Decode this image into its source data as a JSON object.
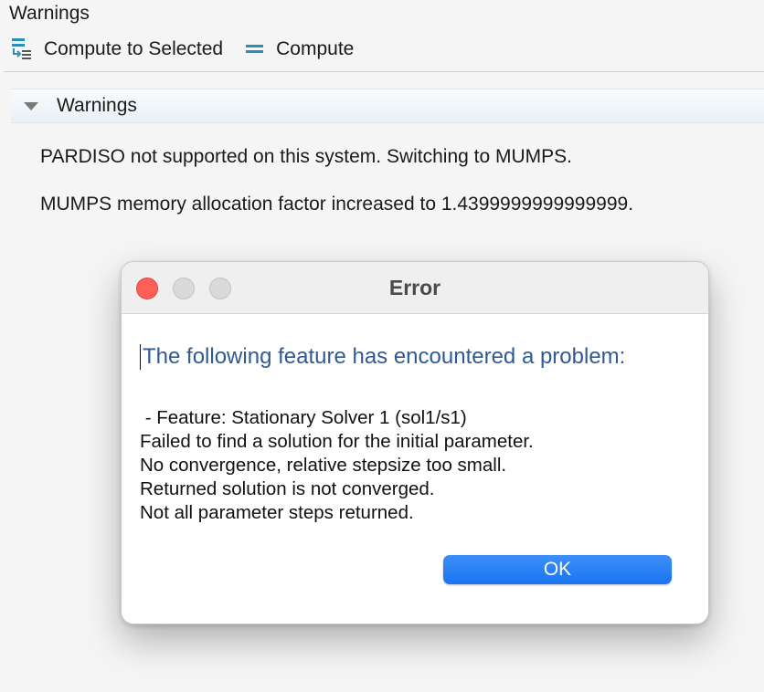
{
  "window": {
    "title": "Warnings"
  },
  "toolbar": {
    "compute_selected_label": "Compute to Selected",
    "compute_label": "Compute",
    "compute_selected_icon": "compute-to-selected-icon",
    "compute_icon": "compute-icon",
    "icon_color": "#2a8fb8"
  },
  "panel": {
    "title": "Warnings",
    "messages": [
      "PARDISO not supported on this system. Switching to MUMPS.",
      "MUMPS memory allocation factor increased to 1.4399999999999999."
    ]
  },
  "dialog": {
    "title": "Error",
    "heading": "The following feature has encountered a problem:",
    "body_lines": [
      " - Feature: Stationary Solver 1 (sol1/s1)",
      "Failed to find a solution for the initial parameter.",
      "No convergence, relative stepsize too small.",
      "Returned solution is not converged.",
      "Not all parameter steps returned."
    ],
    "ok_label": "OK",
    "heading_color": "#2f5a94",
    "ok_color": "#1a74f2",
    "close_color": "#ff5f57"
  }
}
